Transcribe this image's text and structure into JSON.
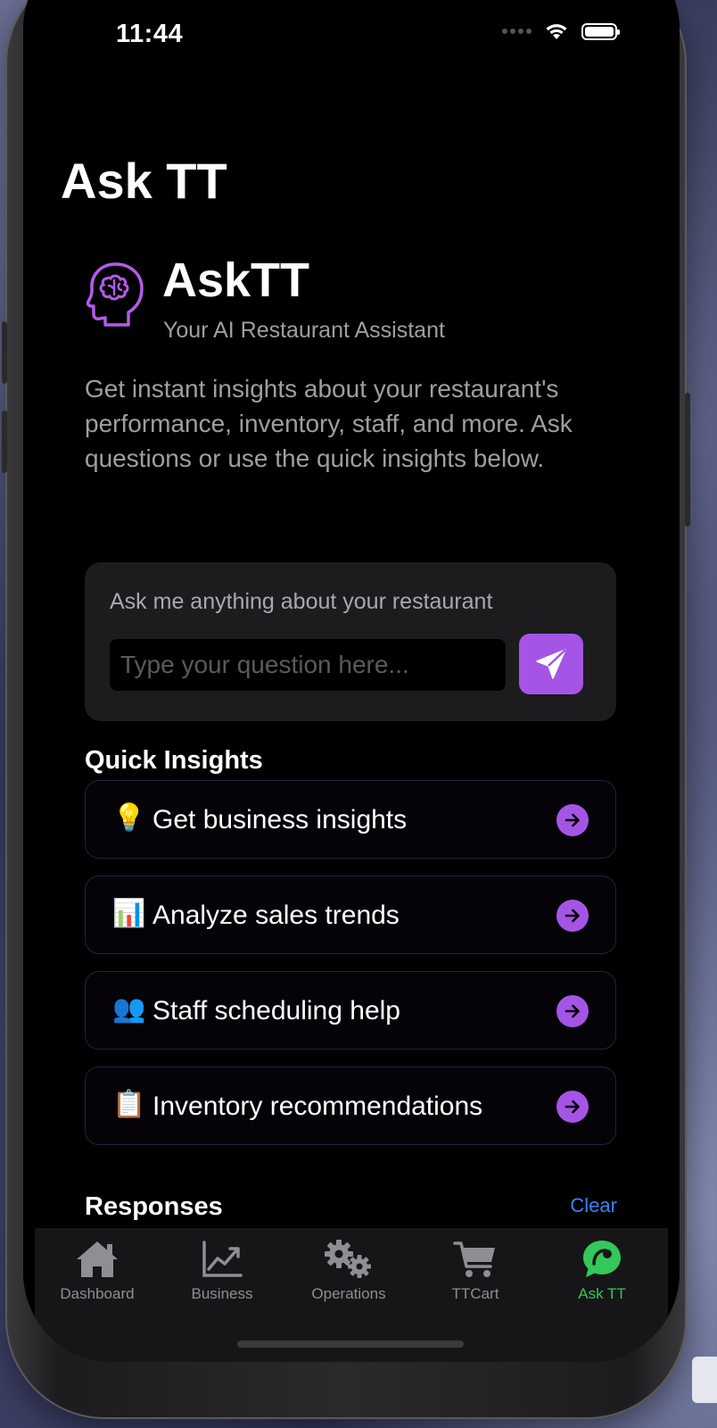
{
  "status_bar": {
    "time": "11:44"
  },
  "page": {
    "title": "Ask TT"
  },
  "hero": {
    "name": "AskTT",
    "subtitle": "Your AI Restaurant Assistant",
    "description": "Get instant insights about your restaurant's performance, inventory, staff, and more. Ask questions or use the quick insights below.",
    "icon": "brain-head-icon",
    "icon_color": "#b45be8"
  },
  "ask": {
    "label": "Ask me anything about your restaurant",
    "placeholder": "Type your question here...",
    "value": "",
    "send_icon": "paper-plane-icon",
    "accent": "#a555e6"
  },
  "quick_insights": {
    "title": "Quick Insights",
    "items": [
      {
        "emoji": "💡",
        "label": "Get business insights"
      },
      {
        "emoji": "📊",
        "label": "Analyze sales trends"
      },
      {
        "emoji": "👥",
        "label": "Staff scheduling help"
      },
      {
        "emoji": "📋",
        "label": "Inventory recommendations"
      }
    ]
  },
  "responses": {
    "title": "Responses",
    "clear_label": "Clear"
  },
  "tab_bar": {
    "items": [
      {
        "label": "Dashboard",
        "icon": "house-icon",
        "active": false
      },
      {
        "label": "Business",
        "icon": "line-chart-icon",
        "active": false
      },
      {
        "label": "Operations",
        "icon": "gears-icon",
        "active": false
      },
      {
        "label": "TTCart",
        "icon": "cart-icon",
        "active": false
      },
      {
        "label": "Ask TT",
        "icon": "chat-bubble-icon",
        "active": true
      }
    ],
    "active_color": "#34c759",
    "inactive_color": "#8e8e93"
  }
}
